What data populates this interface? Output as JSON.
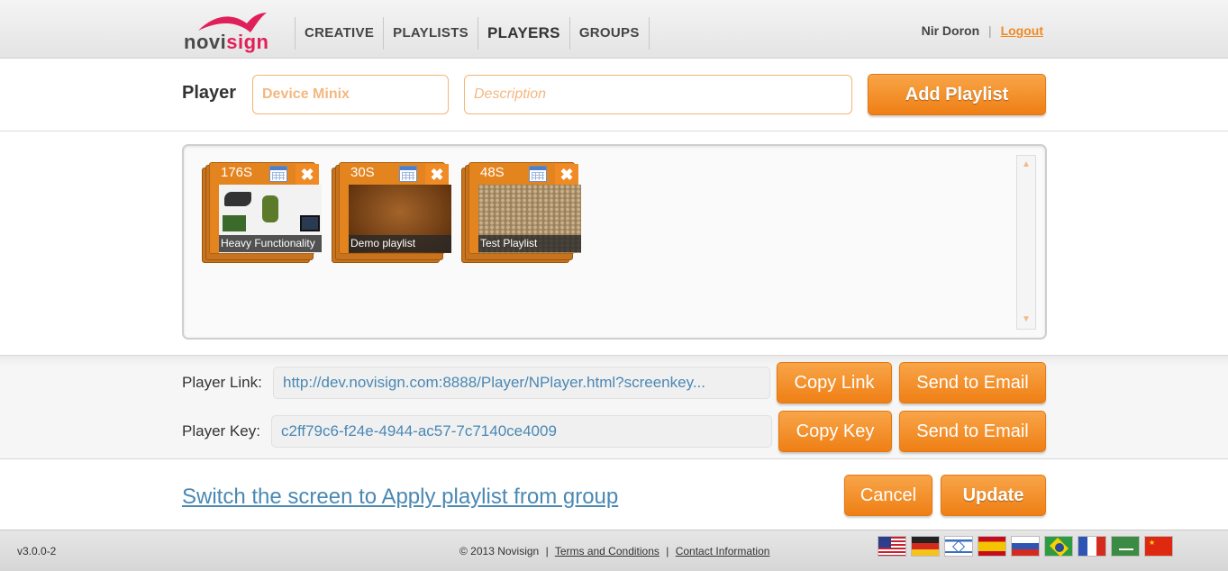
{
  "header": {
    "logo_text_1": "novi",
    "logo_text_2": "sign",
    "nav": [
      "CREATIVE",
      "PLAYLISTS",
      "PLAYERS",
      "GROUPS"
    ],
    "active_nav": "PLAYERS",
    "user_name": "Nir Doron",
    "separator": "|",
    "logout": "Logout"
  },
  "player": {
    "label": "Player",
    "name_placeholder": "Device Minix",
    "description_placeholder": "Description",
    "add_playlist": "Add Playlist"
  },
  "playlists": [
    {
      "duration": "176S",
      "name": "Heavy Functionality"
    },
    {
      "duration": "30S",
      "name": "Demo playlist"
    },
    {
      "duration": "48S",
      "name": "Test Playlist"
    }
  ],
  "links": {
    "player_link_label": "Player Link:",
    "player_link_value": "http://dev.novisign.com:8888/Player/NPlayer.html?screenkey...",
    "copy_link": "Copy Link",
    "send_email_1": "Send to Email",
    "player_key_label": "Player Key:",
    "player_key_value": "c2ff79c6-f24e-4944-ac57-7c7140ce4009",
    "copy_key": "Copy Key",
    "send_email_2": "Send to Email"
  },
  "actions": {
    "switch_link": "Switch the screen to Apply playlist from group",
    "cancel": "Cancel",
    "update": "Update"
  },
  "footer": {
    "version": "v3.0.0-2",
    "copyright": "© 2013 Novisign",
    "sep": "|",
    "terms": "Terms and Conditions",
    "contact": "Contact Information",
    "flags": [
      "us-flag-icon",
      "de-flag-icon",
      "il-flag-icon",
      "es-flag-icon",
      "ru-flag-icon",
      "br-flag-icon",
      "fr-flag-icon",
      "sa-flag-icon",
      "cn-flag-icon"
    ]
  },
  "colors": {
    "accent": "#f08a24",
    "link": "#4a88b4",
    "logo_accent": "#e0205a"
  }
}
